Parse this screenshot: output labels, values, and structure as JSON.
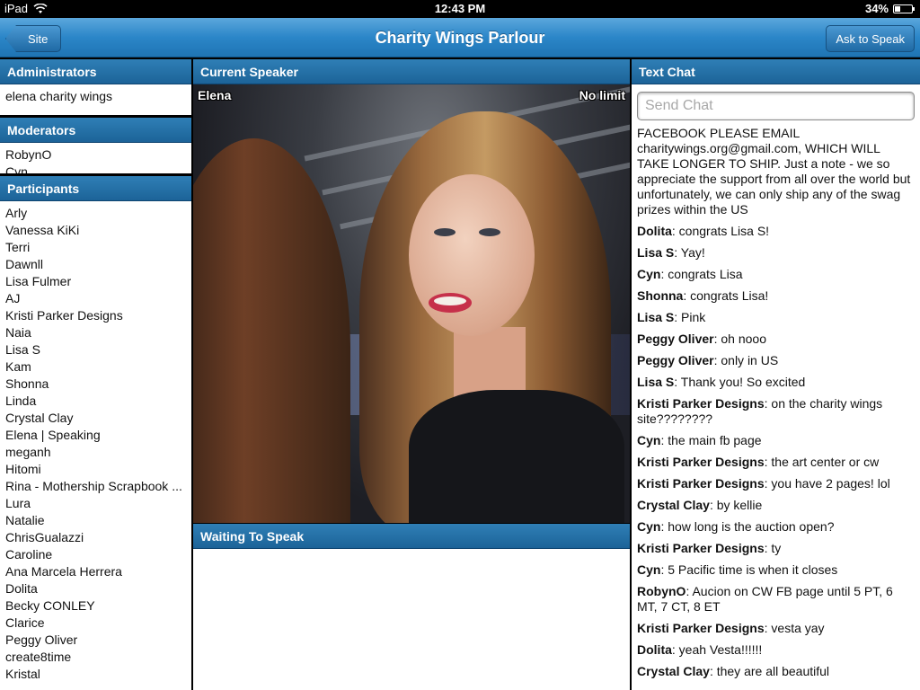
{
  "status_bar": {
    "device": "iPad",
    "time": "12:43 PM",
    "battery": "34%",
    "battery_level": 0.34
  },
  "nav": {
    "title": "Charity Wings Parlour",
    "back_label": "Site",
    "ask_label": "Ask to Speak"
  },
  "administrators": {
    "title": "Administrators",
    "items": [
      "elena charity wings"
    ]
  },
  "moderators": {
    "title": "Moderators",
    "items": [
      "RobynO",
      "Cyn"
    ]
  },
  "participants": {
    "title": "Participants",
    "items": [
      "Arly",
      "Vanessa KiKi",
      "Terri",
      "Dawnll",
      "Lisa Fulmer",
      "AJ",
      "Kristi Parker Designs",
      "Naia",
      "Lisa S",
      "Kam",
      "Shonna",
      "Linda",
      "Crystal Clay",
      "Elena | Speaking",
      "meganh",
      "Hitomi",
      "Rina - Mothership Scrapbook ...",
      "Lura",
      "Natalie",
      "ChrisGualazzi",
      "Caroline",
      "Ana Marcela Herrera",
      "Dolita",
      "Becky CONLEY",
      "Clarice",
      "Peggy Oliver",
      "create8time",
      "Kristal"
    ]
  },
  "current_speaker": {
    "title": "Current Speaker",
    "name": "Elena",
    "limit": "No limit"
  },
  "waiting": {
    "title": "Waiting To Speak"
  },
  "chat": {
    "title": "Text Chat",
    "placeholder": "Send Chat",
    "system_message": "FACEBOOK PLEASE EMAIL charitywings.org@gmail.com, WHICH WILL TAKE LONGER TO SHIP. Just a note - we so appreciate the support from all over the world but unfortunately, we can only ship any of the swag prizes within the US",
    "messages": [
      {
        "user": "Dolita",
        "text": ": congrats Lisa S!"
      },
      {
        "user": "Lisa S",
        "text": ": Yay!"
      },
      {
        "user": "Cyn",
        "text": ": congrats Lisa"
      },
      {
        "user": "Shonna",
        "text": ": congrats Lisa!"
      },
      {
        "user": "Lisa S",
        "text": ": Pink"
      },
      {
        "user": "Peggy Oliver",
        "text": ": oh nooo"
      },
      {
        "user": "Peggy Oliver",
        "text": ": only in US"
      },
      {
        "user": "Lisa S",
        "text": ": Thank you! So excited"
      },
      {
        "user": "Kristi Parker Designs",
        "text": ": on the charity wings site????????"
      },
      {
        "user": "Cyn",
        "text": ": the main fb page"
      },
      {
        "user": "Kristi Parker Designs",
        "text": ": the art center or cw"
      },
      {
        "user": "Kristi Parker Designs",
        "text": ": you have 2 pages! lol"
      },
      {
        "user": "Crystal Clay",
        "text": ": by kellie"
      },
      {
        "user": "Cyn",
        "text": ": how long is the auction open?"
      },
      {
        "user": "Kristi Parker Designs",
        "text": ": ty"
      },
      {
        "user": "Cyn",
        "text": ": 5 Pacific time is when it closes"
      },
      {
        "user": "RobynO",
        "text": ": Aucion on CW FB page until 5 PT, 6 MT, 7 CT, 8 ET"
      },
      {
        "user": "Kristi Parker Designs",
        "text": ": vesta yay"
      },
      {
        "user": "Dolita",
        "text": ": yeah Vesta!!!!!!"
      },
      {
        "user": "Crystal Clay",
        "text": ": they are all beautiful"
      }
    ]
  },
  "icons": {
    "wifi": "wifi-icon",
    "battery": "battery-icon",
    "back": "chevron-left-icon"
  },
  "colors": {
    "nav_blue": "#2b86c8",
    "panel_header": "#1c6398"
  }
}
